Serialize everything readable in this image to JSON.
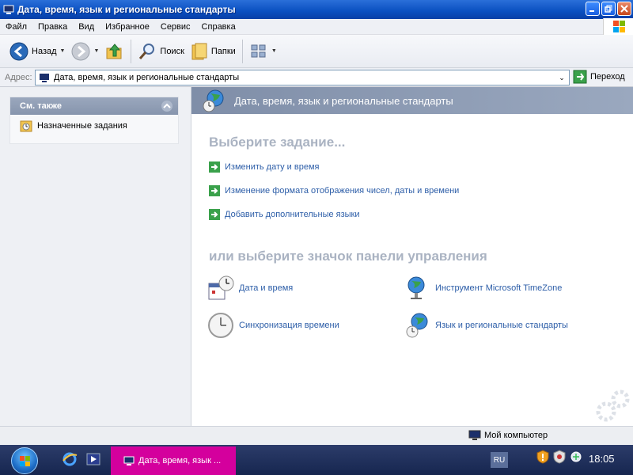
{
  "window": {
    "title": "Дата, время, язык и региональные стандарты"
  },
  "menubar": {
    "items": [
      "Файл",
      "Правка",
      "Вид",
      "Избранное",
      "Сервис",
      "Справка"
    ]
  },
  "toolbar": {
    "back_label": "Назад",
    "search_label": "Поиск",
    "folders_label": "Папки"
  },
  "addressbar": {
    "label": "Адрес:",
    "value": "Дата, время, язык и региональные стандарты",
    "go_label": "Переход"
  },
  "left_pane": {
    "see_also_title": "См. также",
    "see_also_items": [
      "Назначенные задания"
    ]
  },
  "right_pane": {
    "header": "Дата, время, язык и региональные стандарты",
    "pick_task_title": "Выберите задание...",
    "tasks": [
      "Изменить дату и время",
      "Изменение формата отображения чисел, даты и времени",
      "Добавить дополнительные языки"
    ],
    "pick_icon_title": "или выберите значок панели управления",
    "icons": [
      {
        "label": "Дата и время",
        "icon": "calendar-clock-icon"
      },
      {
        "label": "Инструмент Microsoft TimeZone",
        "icon": "globe-mic-icon"
      },
      {
        "label": "Синхронизация времени",
        "icon": "clock-icon"
      },
      {
        "label": "Язык и региональные стандарты",
        "icon": "globe-clock-icon"
      }
    ]
  },
  "statusbar": {
    "zone": "Мой компьютер"
  },
  "taskbar": {
    "window_button": "Дата, время, язык ...",
    "language": "RU",
    "clock": "18:05"
  },
  "colors": {
    "link": "#2d5ea8",
    "section_title": "#aab3c2",
    "header_band": "#8795ad",
    "taskbar_button": "#d4009d"
  }
}
